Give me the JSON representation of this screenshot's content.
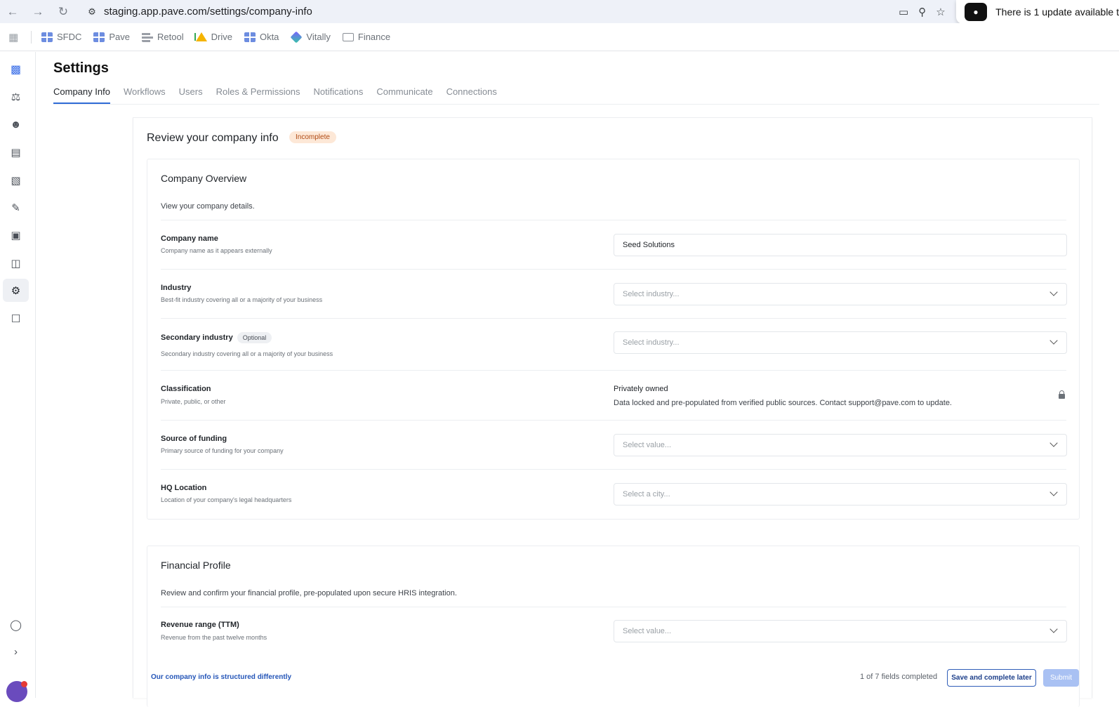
{
  "browser": {
    "url": "staging.app.pave.com/settings/company-info",
    "update_toast": "There is 1 update available t",
    "bookmarks": [
      {
        "label": "SFDC",
        "icon": "sfdc-icon"
      },
      {
        "label": "Pave",
        "icon": "pave-icon"
      },
      {
        "label": "Retool",
        "icon": "retool-icon"
      },
      {
        "label": "Drive",
        "icon": "drive-icon"
      },
      {
        "label": "Okta",
        "icon": "okta-icon"
      },
      {
        "label": "Vitally",
        "icon": "vitally-icon"
      },
      {
        "label": "Finance",
        "icon": "folder-icon"
      }
    ]
  },
  "sidebar": {
    "items": [
      "pave-logo-icon",
      "scales-icon",
      "people-icon",
      "money-icon",
      "building-icon",
      "pencil-icon",
      "gift-icon",
      "document-plus-icon",
      "gear-icon",
      "lock-icon"
    ],
    "bottom": [
      "chat-icon",
      "chevron-right-icon",
      "avatar"
    ],
    "active": "gear-icon"
  },
  "header": {
    "title": "Settings",
    "tabs": [
      "Company Info",
      "Workflows",
      "Users",
      "Roles & Permissions",
      "Notifications",
      "Communicate",
      "Connections"
    ],
    "active_tab": "Company Info"
  },
  "review": {
    "title": "Review your company info",
    "status": "Incomplete"
  },
  "overview": {
    "title": "Company Overview",
    "subtitle": "View your company details.",
    "fields": {
      "company_name": {
        "label": "Company name",
        "help": "Company name as it appears externally",
        "value": "Seed Solutions"
      },
      "industry": {
        "label": "Industry",
        "help": "Best-fit industry covering all or a majority of your business",
        "placeholder": "Select industry..."
      },
      "secondary_industry": {
        "label": "Secondary industry",
        "badge": "Optional",
        "help": "Secondary industry covering all or a majority of your business",
        "placeholder": "Select industry..."
      },
      "classification": {
        "label": "Classification",
        "help": "Private, public, or other",
        "value": "Privately owned",
        "note": "Data locked and pre-populated from verified public sources. Contact support@pave.com to update."
      },
      "funding": {
        "label": "Source of funding",
        "help": "Primary source of funding for your company",
        "placeholder": "Select value..."
      },
      "hq": {
        "label": "HQ Location",
        "help": "Location of your company's legal headquarters",
        "placeholder": "Select a city..."
      }
    }
  },
  "financial": {
    "title": "Financial Profile",
    "subtitle": "Review and confirm your financial profile, pre-populated upon secure HRIS integration.",
    "fields": {
      "revenue": {
        "label": "Revenue range (TTM)",
        "help": "Revenue from the past twelve months",
        "placeholder": "Select value..."
      }
    }
  },
  "footer": {
    "link": "Our company info is structured differently",
    "progress": "1 of 7 fields completed",
    "save_label": "Save and complete later",
    "submit_label": "Submit"
  }
}
